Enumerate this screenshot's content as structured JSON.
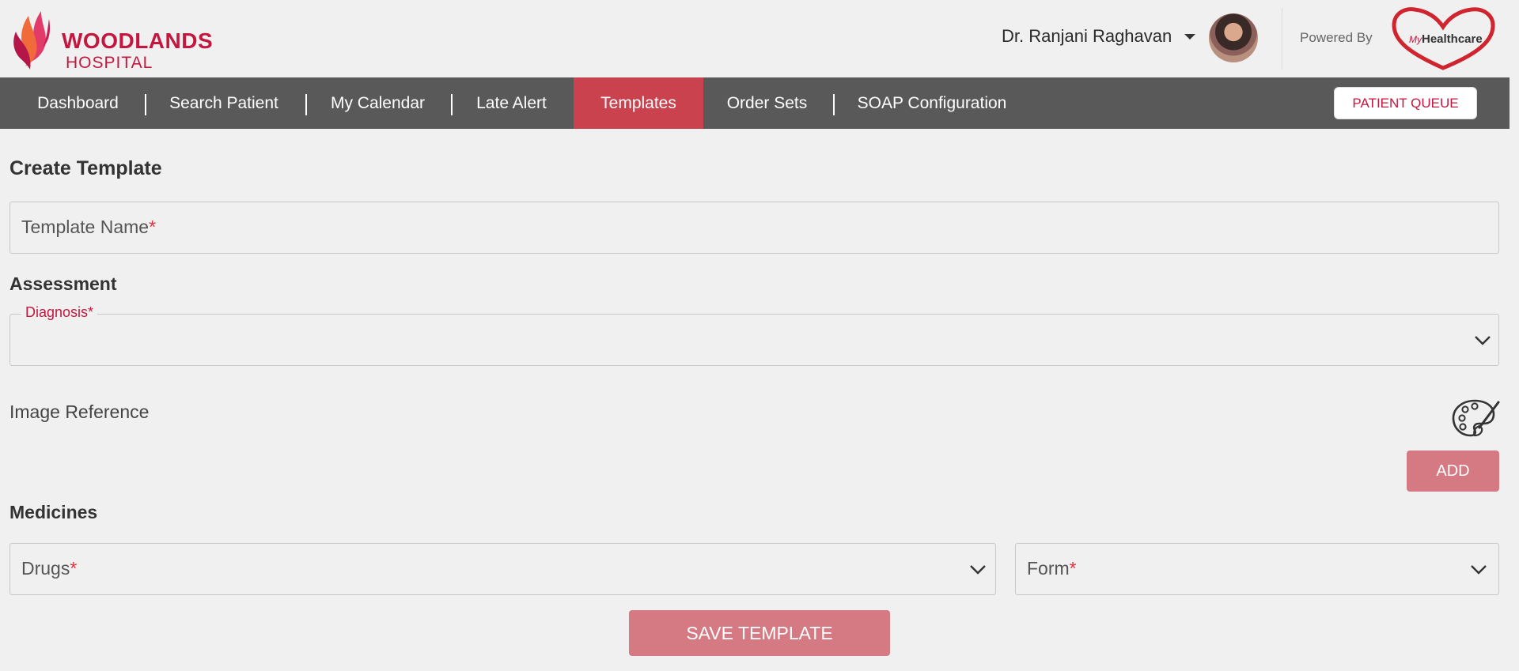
{
  "header": {
    "logo_line1": "WOODLANDS",
    "logo_line2": "HOSPITAL",
    "user_name": "Dr. Ranjani Raghavan",
    "powered_by": "Powered By",
    "partner_logo_prefix": "My",
    "partner_logo_name": "Healthcare",
    "brand_color": "#c4173f"
  },
  "nav": {
    "items": [
      {
        "label": "Dashboard"
      },
      {
        "label": "Search Patient"
      },
      {
        "label": "My Calendar"
      },
      {
        "label": "Late Alert"
      },
      {
        "label": "Templates",
        "active": true
      },
      {
        "label": "Order Sets"
      },
      {
        "label": "SOAP Configuration"
      }
    ],
    "queue_button": "PATIENT QUEUE",
    "bar_color": "#595959",
    "active_color": "#c9424e"
  },
  "form": {
    "title": "Create Template",
    "template_name_label": "Template Name",
    "assessment_title": "Assessment",
    "diagnosis_label": "Diagnosis*",
    "image_reference_label": "Image Reference",
    "add_button": "ADD",
    "medicines_title": "Medicines",
    "drugs_label": "Drugs",
    "form_label": "Form",
    "required_mark": "*",
    "save_button": "SAVE TEMPLATE",
    "button_color": "#d57982"
  },
  "icons": {
    "caret": "caret-down-icon",
    "chevron": "chevron-down-icon",
    "palette": "palette-icon"
  }
}
